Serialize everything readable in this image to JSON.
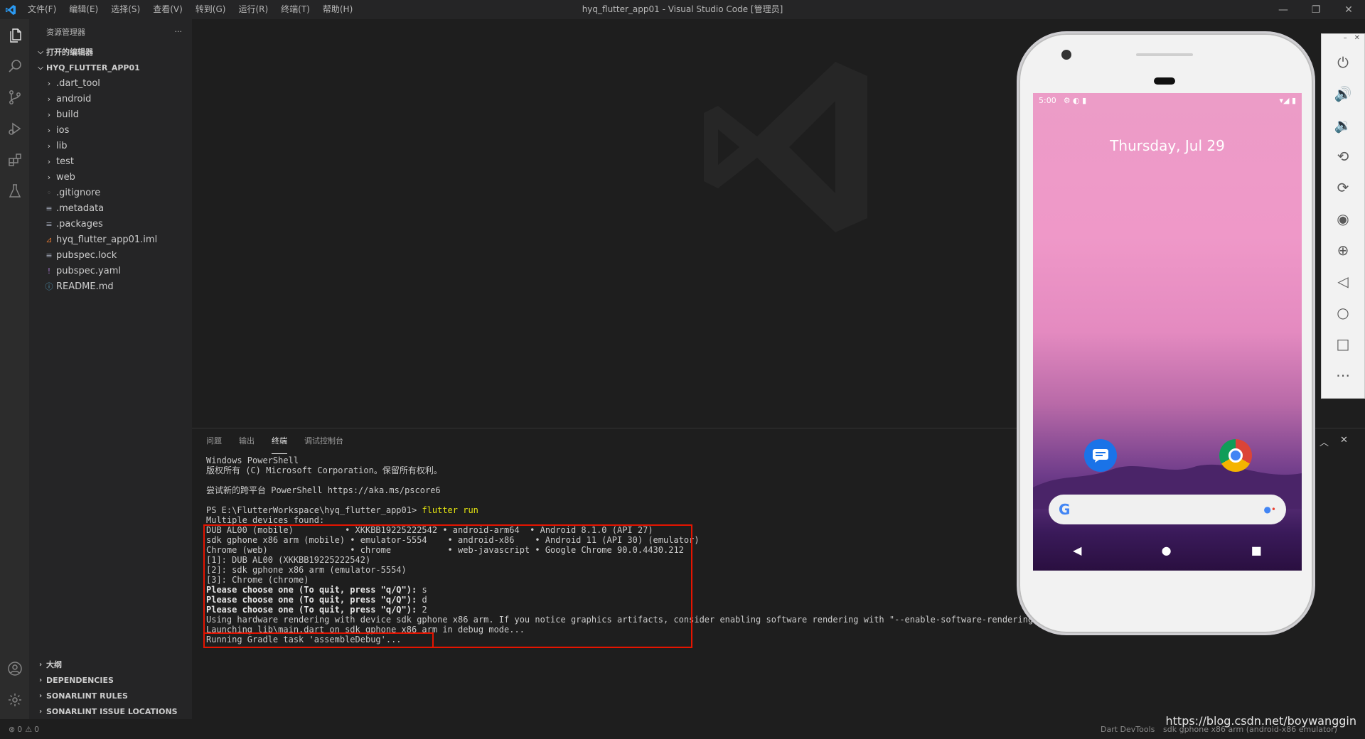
{
  "titlebar": {
    "menus": [
      "文件(F)",
      "编辑(E)",
      "选择(S)",
      "查看(V)",
      "转到(G)",
      "运行(R)",
      "终端(T)",
      "帮助(H)"
    ],
    "window_title": "hyq_flutter_app01 - Visual Studio Code [管理员]"
  },
  "sidebar": {
    "header": "资源管理器",
    "header_more": "···",
    "open_editors": "打开的编辑器",
    "project": "HYQ_FLUTTER_APP01",
    "folders": [
      ".dart_tool",
      "android",
      "build",
      "ios",
      "lib",
      "test",
      "web"
    ],
    "files": [
      {
        "name": ".gitignore",
        "icon": "◦",
        "color": "#6d6d6d"
      },
      {
        "name": ".metadata",
        "icon": "≡",
        "color": "#9da5b4"
      },
      {
        "name": ".packages",
        "icon": "≡",
        "color": "#9da5b4"
      },
      {
        "name": "hyq_flutter_app01.iml",
        "icon": "⊿",
        "color": "#e37933"
      },
      {
        "name": "pubspec.lock",
        "icon": "≡",
        "color": "#9da5b4"
      },
      {
        "name": "pubspec.yaml",
        "icon": "!",
        "color": "#a074c4"
      },
      {
        "name": "README.md",
        "icon": "ⓘ",
        "color": "#519aba"
      }
    ],
    "bottom_sections": [
      "大纲",
      "DEPENDENCIES",
      "SONARLINT RULES",
      "SONARLINT ISSUE LOCATIONS"
    ]
  },
  "panel": {
    "tabs": [
      "问题",
      "输出",
      "终端",
      "调试控制台"
    ],
    "active_tab": "终端"
  },
  "terminal": {
    "lines": [
      {
        "text": "Windows PowerShell",
        "style": ""
      },
      {
        "text": "版权所有 (C) Microsoft Corporation。保留所有权利。",
        "style": ""
      },
      {
        "text": "",
        "style": ""
      },
      {
        "text": "尝试新的跨平台 PowerShell https://aka.ms/pscore6",
        "style": ""
      },
      {
        "text": "",
        "style": ""
      },
      {
        "text": "PS E:\\FlutterWorkspace\\hyq_flutter_app01> ",
        "style": "",
        "cmd": "flutter run"
      },
      {
        "text": "Multiple devices found:",
        "style": ""
      },
      {
        "text": "DUB AL00 (mobile)          • XKKBB19225222542 • android-arm64  • Android 8.1.0 (API 27)",
        "style": ""
      },
      {
        "text": "sdk gphone x86 arm (mobile) • emulator-5554    • android-x86    • Android 11 (API 30) (emulator)",
        "style": ""
      },
      {
        "text": "Chrome (web)                • chrome           • web-javascript • Google Chrome 90.0.4430.212",
        "style": ""
      },
      {
        "text": "[1]: DUB AL00 (XKKBB19225222542)",
        "style": ""
      },
      {
        "text": "[2]: sdk gphone x86 arm (emulator-5554)",
        "style": ""
      },
      {
        "text": "[3]: Chrome (chrome)",
        "style": ""
      },
      {
        "text": "Please choose one (To quit, press \"q/Q\"): ",
        "style": "b",
        "cmd2": "s"
      },
      {
        "text": "Please choose one (To quit, press \"q/Q\"): ",
        "style": "b",
        "cmd2": "d"
      },
      {
        "text": "Please choose one (To quit, press \"q/Q\"): ",
        "style": "b",
        "cmd2": "2"
      },
      {
        "text": "Using hardware rendering with device sdk gphone x86 arm. If you notice graphics artifacts, consider enabling software rendering with \"--enable-software-rendering\".",
        "style": ""
      },
      {
        "text": "Launching lib\\main.dart on sdk gphone x86 arm in debug mode...",
        "style": ""
      },
      {
        "text": "Running Gradle task 'assembleDebug'...",
        "style": ""
      }
    ]
  },
  "emulator": {
    "time": "5:00",
    "date": "Thursday, Jul 29"
  },
  "statusbar": {
    "errors": "0",
    "warnings": "0",
    "dart_devtools": "Dart DevTools",
    "device": "sdk gphone x86 arm (android-x86 emulator)"
  },
  "watermark": "https://blog.csdn.net/boywanggin",
  "colors": {
    "accent_red": "#e51400",
    "activity_bg": "#2c2c2c",
    "sidebar_bg": "#252526"
  }
}
